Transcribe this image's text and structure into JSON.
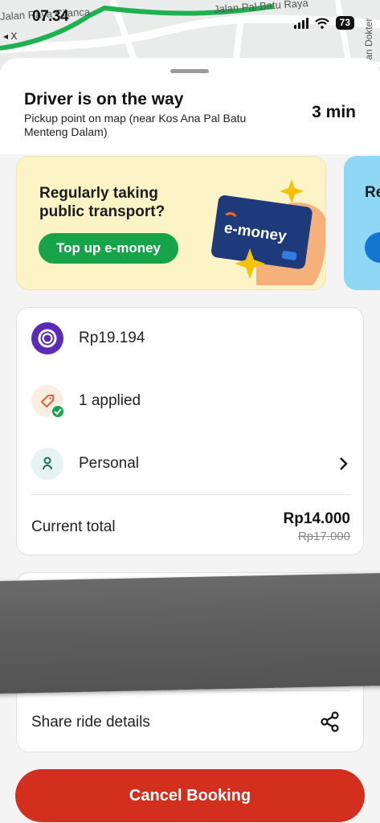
{
  "status_bar": {
    "time": "07.34",
    "battery": "73"
  },
  "map": {
    "street_left": "Jalan Raya Cilanca",
    "street_top": "Jalan Pal Batu Raya",
    "street_right": "Jalan Dokter",
    "back_label": "◂ X"
  },
  "trip": {
    "status": "Driver is on the way",
    "pickup": "Pickup point on map (near Kos Ana Pal Batu Menteng Dalam)",
    "eta": "3 min"
  },
  "promo": {
    "title": "Regularly taking public transport?",
    "button": "Top up e-money",
    "card_text": "e-money",
    "next_title": "Re fo"
  },
  "payment": {
    "balance": "Rp19.194",
    "promo": "1 applied",
    "profile": "Personal",
    "total_label": "Current total",
    "total_value": "Rp14.000",
    "original_value": "Rp17.000"
  },
  "share": {
    "label": "Share ride details"
  },
  "cancel": {
    "label": "Cancel Booking"
  },
  "colors": {
    "primary_green": "#16a349",
    "cancel_red": "#d22f1f",
    "wallet_purple": "#5b2bb5",
    "promo_bg": "#fcf3c6"
  }
}
